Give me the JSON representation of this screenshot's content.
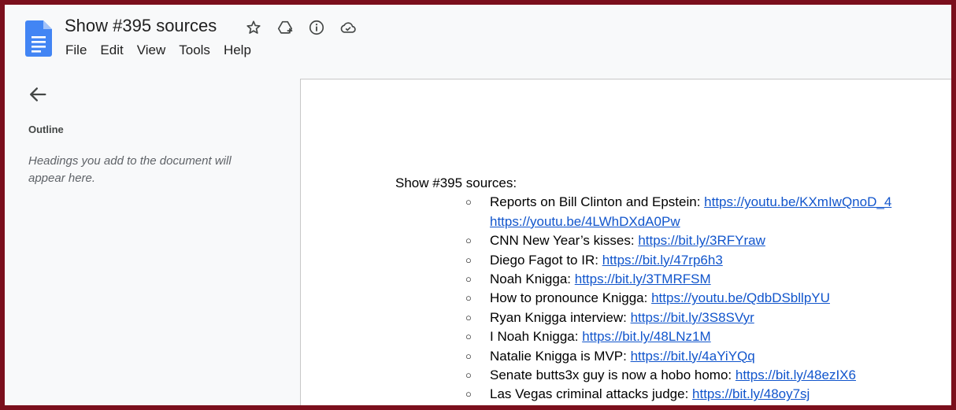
{
  "app": {
    "title": "Show #395 sources",
    "icons": [
      "star-icon",
      "move-to-drive-icon",
      "info-icon",
      "cloud-status-icon"
    ],
    "accent": "#1a73e8"
  },
  "menu": [
    "File",
    "Edit",
    "View",
    "Tools",
    "Help"
  ],
  "sidebar": {
    "outline_label": "Outline",
    "hint": "Headings you add to the document will appear here."
  },
  "document": {
    "heading": "Show #395 sources:",
    "items": [
      {
        "text": "Reports on Bill Clinton and Epstein: ",
        "link": "https://youtu.be/KXmIwQnoD_4",
        "link2": "https://youtu.be/4LWhDXdA0Pw"
      },
      {
        "text": "CNN New Year’s kisses: ",
        "link": "https://bit.ly/3RFYraw"
      },
      {
        "text": "Diego Fagot to IR: ",
        "link": "https://bit.ly/47rp6h3"
      },
      {
        "text": "Noah Knigga: ",
        "link": "https://bit.ly/3TMRFSM"
      },
      {
        "text": "How to pronounce Knigga: ",
        "link": "https://youtu.be/QdbDSbllpYU"
      },
      {
        "text": "Ryan Knigga interview: ",
        "link": "https://bit.ly/3S8SVyr"
      },
      {
        "text": "I Noah Knigga: ",
        "link": "https://bit.ly/48LNz1M"
      },
      {
        "text": "Natalie Knigga is MVP: ",
        "link": "https://bit.ly/4aYiYQq"
      },
      {
        "text": "Senate butts3x guy is now a hobo homo: ",
        "link": "https://bit.ly/48ezIX6"
      },
      {
        "text": "Las Vegas criminal attacks judge: ",
        "link": "https://bit.ly/48oy7sj"
      }
    ]
  }
}
